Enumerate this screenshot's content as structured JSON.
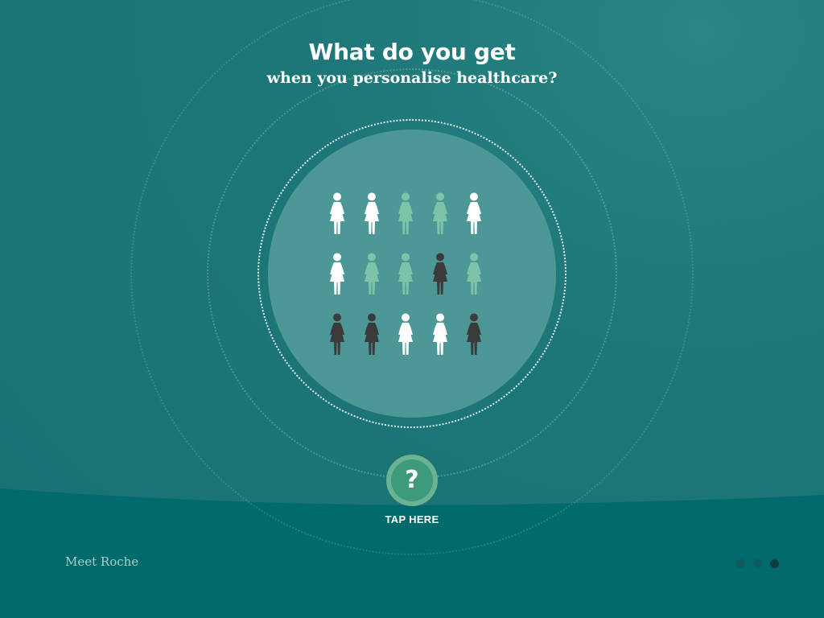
{
  "header": {
    "title": "What do you get",
    "subtitle": "when you personalise healthcare?"
  },
  "figures": {
    "colors": {
      "white": "#ffffff",
      "green": "#7cc3a8",
      "dark": "#3b3b3b"
    },
    "rows": [
      [
        "white",
        "white",
        "green",
        "green",
        "white"
      ],
      [
        "white",
        "green",
        "green",
        "dark",
        "green"
      ],
      [
        "dark",
        "dark",
        "white",
        "white",
        "dark"
      ]
    ],
    "icon": "woman-figure-icon"
  },
  "tap": {
    "symbol": "?",
    "label": "TAP HERE",
    "icon": "question-mark-icon"
  },
  "footer": {
    "brand": "Meet Roche"
  },
  "pager": {
    "count": 3,
    "active_index": 2,
    "colors": {
      "inactive": "#0f5a5d",
      "active": "#123b3e"
    }
  },
  "theme": {
    "background": "#1c6f73",
    "band": "#006a6c",
    "disc": "#4e9797",
    "button_outer": "#6cb393",
    "button_inner": "#3d9a7c"
  }
}
